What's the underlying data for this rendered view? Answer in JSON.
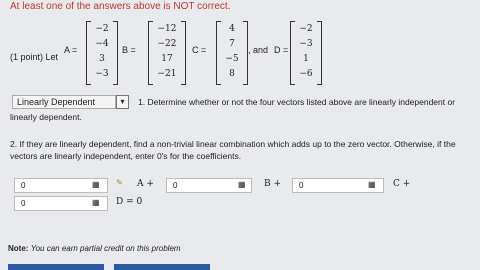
{
  "warning": "At least one of the answers above is NOT correct.",
  "problem": {
    "prefix": "(1 point) Let",
    "A": {
      "name": "A =",
      "values": [
        "−2",
        "−4",
        "3",
        "−3"
      ]
    },
    "B": {
      "name": "B =",
      "values": [
        "−12",
        "−22",
        "17",
        "−21"
      ]
    },
    "C": {
      "name": "C =",
      "values": [
        "4",
        "7",
        "−5",
        "8"
      ]
    },
    "D": {
      "name": "D =",
      "values": [
        "−2",
        "−3",
        "1",
        "−6"
      ]
    },
    "and": ", and"
  },
  "question1": {
    "selected": "Linearly Dependent",
    "text": "1. Determine whether or not the four vectors listed above are linearly independent or",
    "text2": "linearly dependent."
  },
  "question2": {
    "line1": "2. If they are linearly dependent, find a non-trivial linear combination which adds up to the zero vector. Otherwise, if the",
    "line2": "vectors are linearly independent, enter 0's for the coefficients.",
    "inputs": [
      "0",
      "0",
      "0",
      "0"
    ],
    "terms": [
      "A +",
      "B +",
      "C +",
      "D = 0"
    ]
  },
  "note": {
    "label": "Note:",
    "text": "You can earn partial credit on this problem"
  },
  "colors": {
    "warning": "#c0392b",
    "button": "#2c5aa0",
    "background": "#e9eaee"
  }
}
